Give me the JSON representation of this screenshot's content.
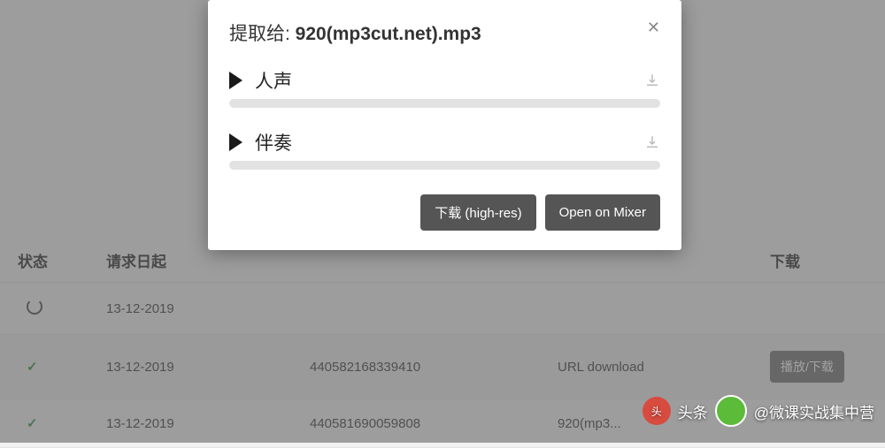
{
  "modal": {
    "title_prefix": "提取给: ",
    "filename": "920(mp3cut.net).mp3",
    "tracks": [
      {
        "label": "人声"
      },
      {
        "label": "伴奏"
      }
    ],
    "download_hires": "下载 (high-res)",
    "open_mixer": "Open on Mixer"
  },
  "table": {
    "headers": {
      "status": "状态",
      "request_date": "请求日起",
      "id": "",
      "source": "",
      "download": "下载"
    },
    "rows": [
      {
        "status": "loading",
        "date": "13-12-2019",
        "id": "",
        "source": "",
        "action": ""
      },
      {
        "status": "done",
        "date": "13-12-2019",
        "id": "440582168339410",
        "source": "URL download",
        "action": "播放/下载"
      },
      {
        "status": "done",
        "date": "13-12-2019",
        "id": "440581690059808",
        "source": "920(mp3...",
        "action": ""
      }
    ]
  },
  "watermark": {
    "label1": "头条",
    "label2": "@微课实战集中营"
  }
}
